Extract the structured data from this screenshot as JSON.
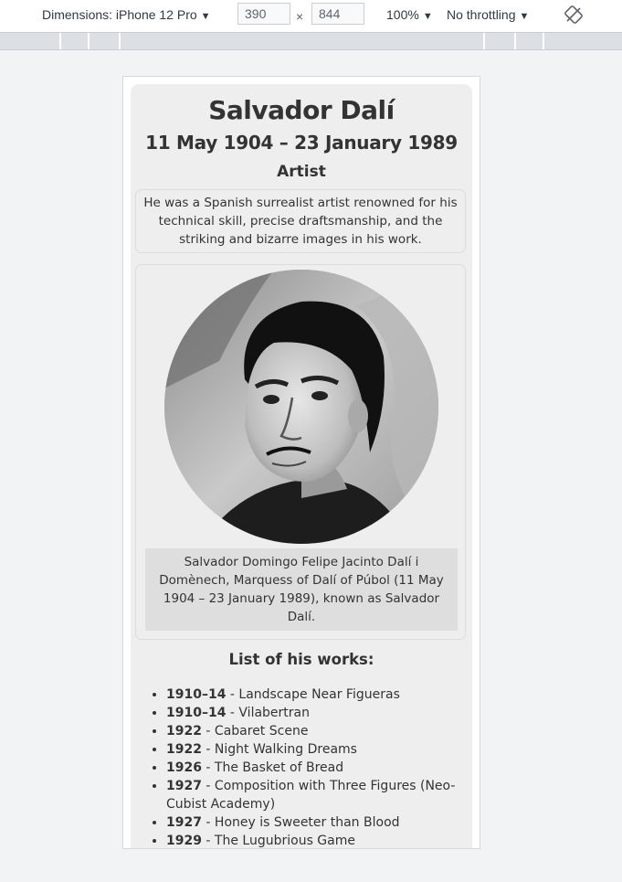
{
  "devtools": {
    "device_label": "Dimensions: iPhone 12 Pro",
    "width": "390",
    "height": "844",
    "times": "×",
    "zoom": "100%",
    "throttling": "No throttling"
  },
  "page": {
    "name": "Salvador Dalí",
    "dates": "11 May 1904 – 23 January 1989",
    "role": "Artist",
    "summary": "He was a Spanish surrealist artist renowned for his technical skill, precise draftsmanship, and the striking and bizarre images in his work.",
    "caption": "Salvador Domingo Felipe Jacinto Dalí i Domènech, Marquess of Dalí of Púbol (11 May 1904 – 23 January 1989), known as Salvador Dalí.",
    "works_title": "List of his works:",
    "works": [
      {
        "year": "1910–14",
        "title": " - Landscape Near Figueras"
      },
      {
        "year": "1910–14",
        "title": " - Vilabertran"
      },
      {
        "year": "1922",
        "title": " - Cabaret Scene"
      },
      {
        "year": "1922",
        "title": " - Night Walking Dreams"
      },
      {
        "year": "1926",
        "title": " - The Basket of Bread"
      },
      {
        "year": "1927",
        "title": " - Composition with Three Figures (Neo-Cubist Academy)"
      },
      {
        "year": "1927",
        "title": " - Honey is Sweeter than Blood"
      },
      {
        "year": "1929",
        "title": " - The Lugubrious Game"
      }
    ]
  }
}
